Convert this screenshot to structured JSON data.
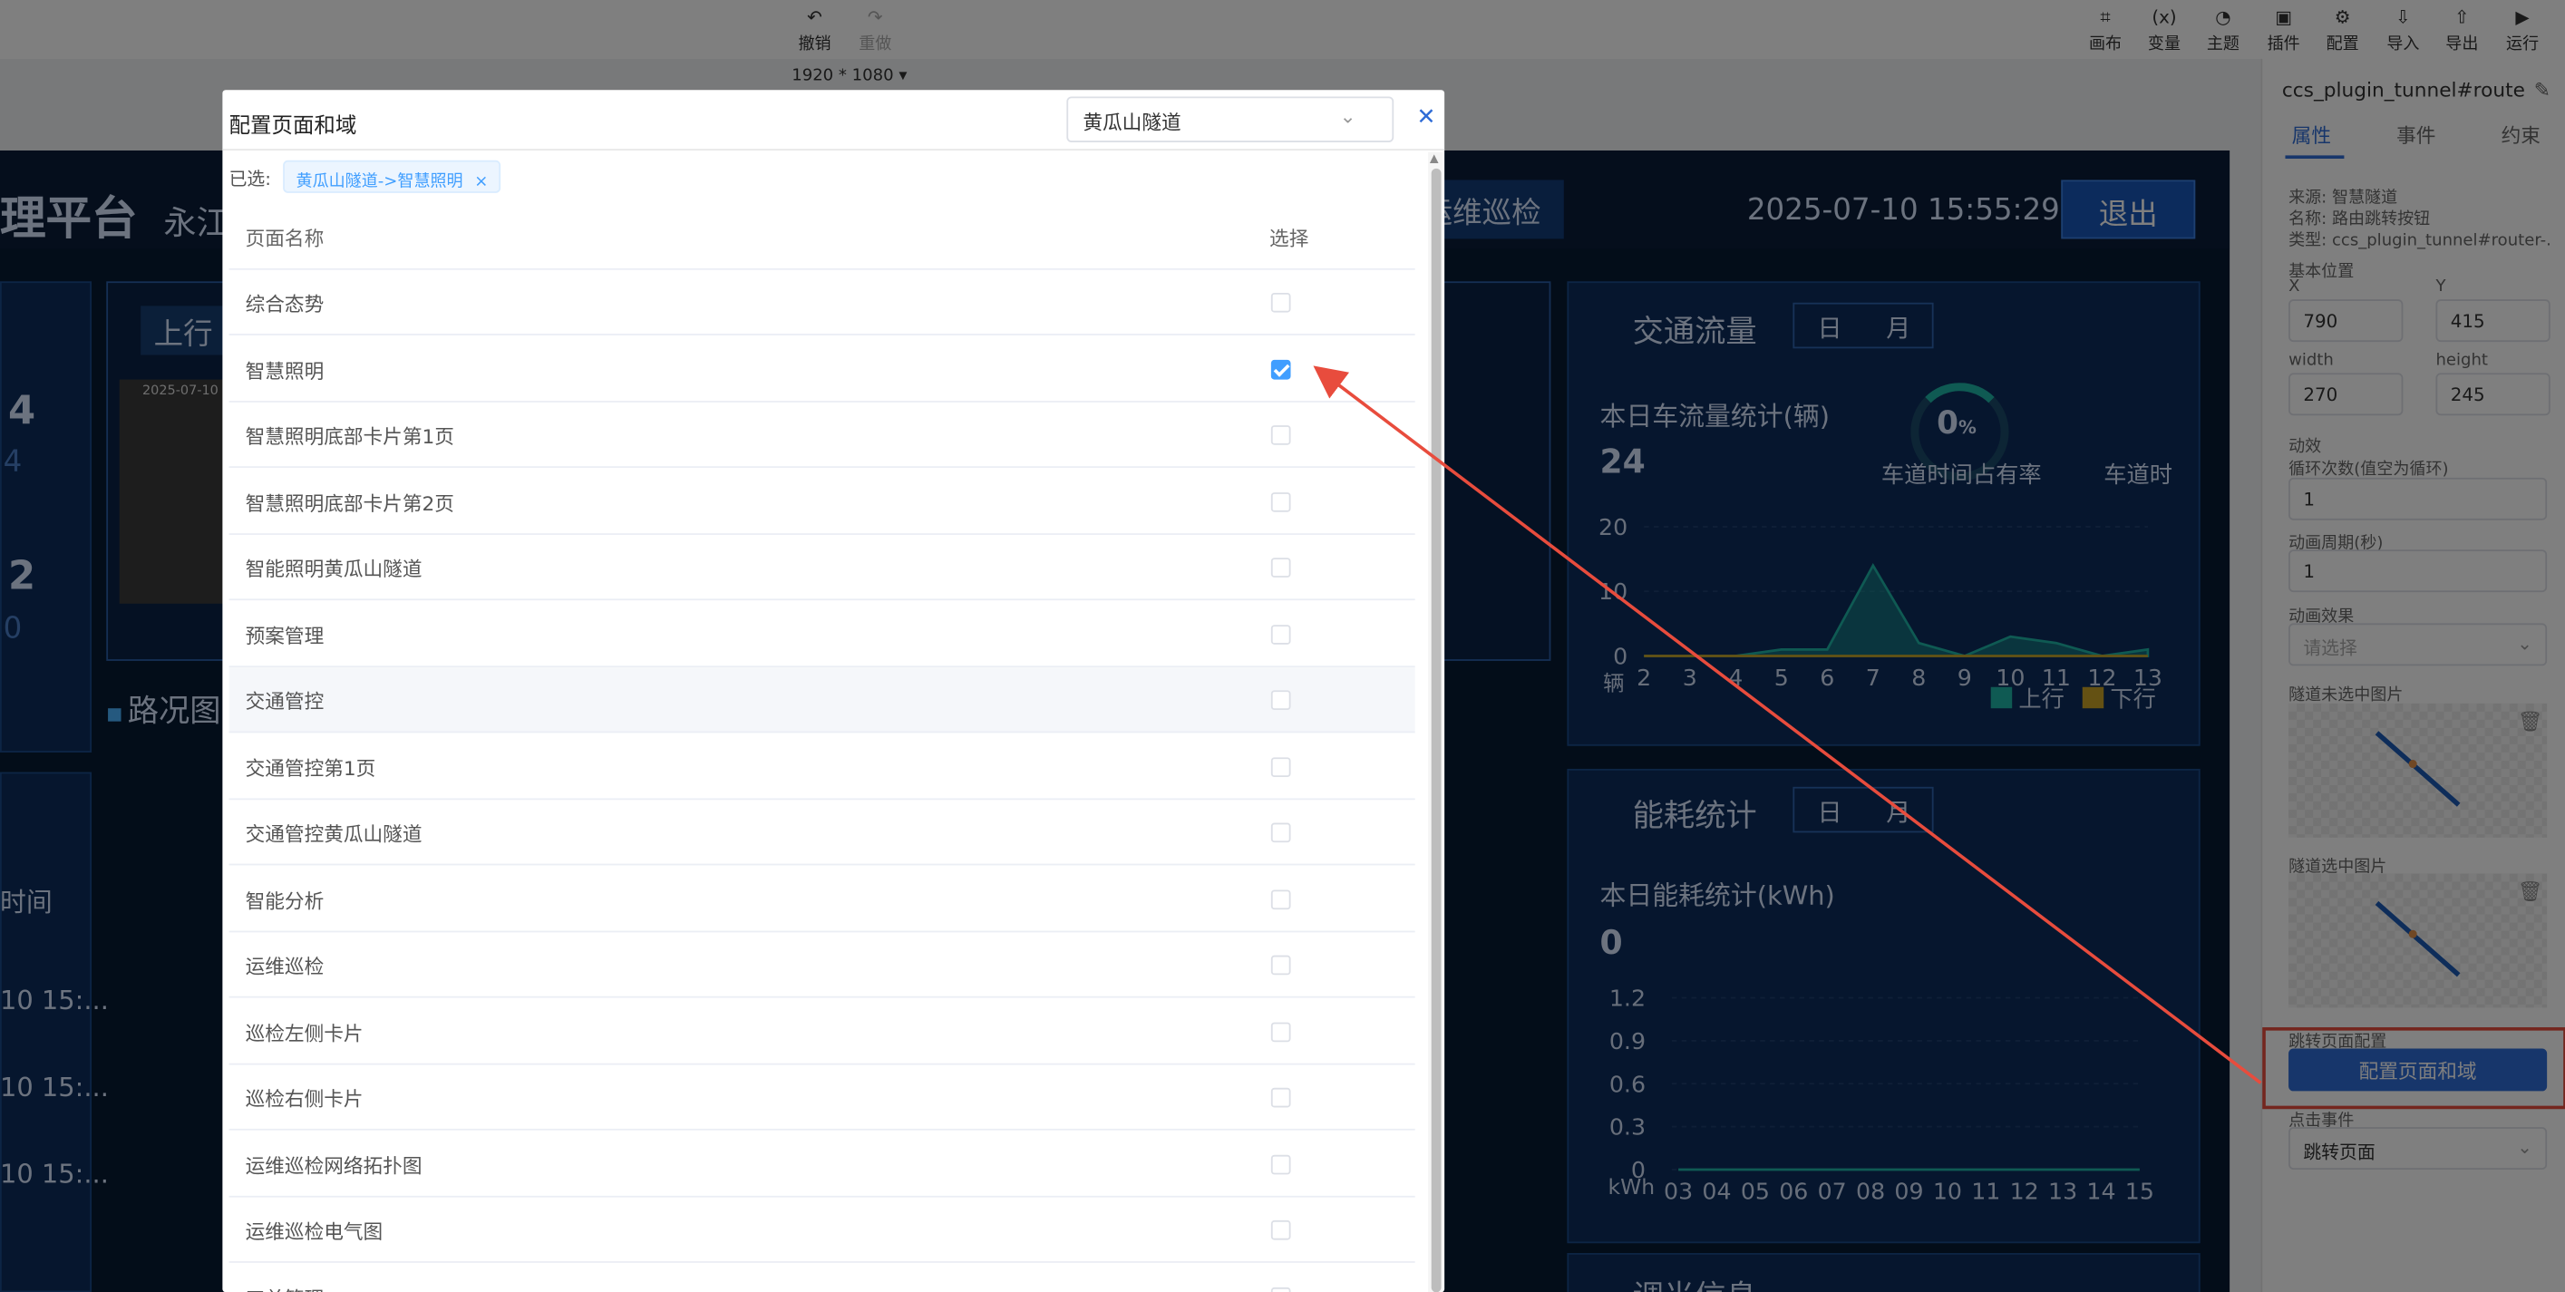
{
  "toolbar": {
    "undo": "撤销",
    "redo": "重做",
    "canvas": "画布",
    "variable": "变量",
    "theme": "主题",
    "plugin": "插件",
    "config": "配置",
    "import": "导入",
    "export": "导出",
    "run": "运行",
    "resolution": "1920 * 1080"
  },
  "screen": {
    "title_partial": "理平台",
    "sub_partial": "永江",
    "nav_partial": "运维巡检",
    "datetime": "2025-07-10 15:55:29",
    "logout": "退出",
    "up_label": "上行",
    "cam_time": "2025-07-10",
    "left_num1": "4",
    "left_num1b": "4",
    "left_num2": "2",
    "left_num2b": "0",
    "road_title": "路况图",
    "time_label": "时间",
    "time_rows": [
      "10 15:...",
      "10 15:...",
      "10 15:..."
    ],
    "hidden_title": "调光信息"
  },
  "traffic": {
    "title": "交通流量",
    "tab_day": "日",
    "tab_month": "月",
    "stat_label": "本日车流量统计(辆)",
    "stat_value": "24",
    "gauge_value": "0",
    "gauge_unit": "%",
    "gauge_label": "车道时间占有率",
    "gauge2_label": "车道时",
    "ylabel": "辆",
    "legend_up": "上行",
    "legend_down": "下行"
  },
  "energy": {
    "title": "能耗统计",
    "tab_day": "日",
    "tab_month": "月",
    "stat_label": "本日能耗统计(kWh)",
    "stat_value": "0",
    "ylabel": "kWh"
  },
  "chart_data": [
    {
      "type": "area",
      "title": "",
      "x": [
        "2",
        "3",
        "4",
        "5",
        "6",
        "7",
        "8",
        "9",
        "10",
        "11",
        "12",
        "13"
      ],
      "ylim": [
        0,
        20
      ],
      "yticks": [
        "20",
        "10",
        "0"
      ],
      "series": [
        {
          "name": "上行",
          "values": [
            0,
            0,
            0,
            1,
            1,
            14,
            2,
            0,
            3,
            2,
            0,
            1
          ]
        },
        {
          "name": "下行",
          "values": [
            0,
            0,
            0,
            0,
            0,
            0,
            0,
            0,
            0,
            0,
            0,
            0
          ]
        }
      ]
    },
    {
      "type": "line",
      "title": "",
      "x": [
        "03",
        "04",
        "05",
        "06",
        "07",
        "08",
        "09",
        "10",
        "11",
        "12",
        "13",
        "14",
        "15"
      ],
      "ylim": [
        0,
        1.2
      ],
      "yticks": [
        "1.2",
        "0.9",
        "0.6",
        "0.3",
        "0"
      ],
      "series": [
        {
          "values": [
            0,
            0,
            0,
            0,
            0,
            0,
            0,
            0,
            0,
            0,
            0,
            0,
            0
          ]
        }
      ]
    }
  ],
  "right_panel": {
    "component_name": "ccs_plugin_tunnel#router...",
    "tabs": [
      "属性",
      "事件",
      "约束"
    ],
    "source": "来源: 智慧隧道",
    "name": "名称: 路由跳转按钮",
    "type": "类型: ccs_plugin_tunnel#router-...",
    "base_position": "基本位置",
    "x_label": "X",
    "y_label": "Y",
    "x": "790",
    "y": "415",
    "width_label": "width",
    "height_label": "height",
    "width": "270",
    "height": "245",
    "anim_label": "动效",
    "loop_label": "循环次数(值空为循环)",
    "loop": "1",
    "period_label": "动画周期(秒)",
    "period": "1",
    "effect_label": "动画效果",
    "effect_placeholder": "请选择",
    "unselected_img": "隧道未选中图片",
    "selected_img": "隧道选中图片",
    "jump_label": "跳转页面配置",
    "config_button": "配置页面和域",
    "click_label": "点击事件",
    "click_value": "跳转页面"
  },
  "modal": {
    "title": "配置页面和域",
    "domain": "黄瓜山隧道",
    "selected_label": "已选:",
    "selected_tag": "黄瓜山隧道->智慧照明",
    "col_name": "页面名称",
    "col_select": "选择",
    "rows": [
      {
        "name": "综合态势",
        "checked": false
      },
      {
        "name": "智慧照明",
        "checked": true
      },
      {
        "name": "智慧照明底部卡片第1页",
        "checked": false
      },
      {
        "name": "智慧照明底部卡片第2页",
        "checked": false
      },
      {
        "name": "智能照明黄瓜山隧道",
        "checked": false
      },
      {
        "name": "预案管理",
        "checked": false
      },
      {
        "name": "交通管控",
        "checked": false
      },
      {
        "name": "交通管控第1页",
        "checked": false
      },
      {
        "name": "交通管控黄瓜山隧道",
        "checked": false
      },
      {
        "name": "智能分析",
        "checked": false
      },
      {
        "name": "运维巡检",
        "checked": false
      },
      {
        "name": "巡检左侧卡片",
        "checked": false
      },
      {
        "name": "巡检右侧卡片",
        "checked": false
      },
      {
        "name": "运维巡检网络拓扑图",
        "checked": false
      },
      {
        "name": "运维巡检电气图",
        "checked": false
      },
      {
        "name": "工单管理",
        "checked": false
      }
    ]
  },
  "colors": {
    "accent": "#409eff",
    "primary_button": "#2f6cd6",
    "annotation": "#e84c3d",
    "teal": "#1fb5a7",
    "gold": "#c9a227"
  }
}
